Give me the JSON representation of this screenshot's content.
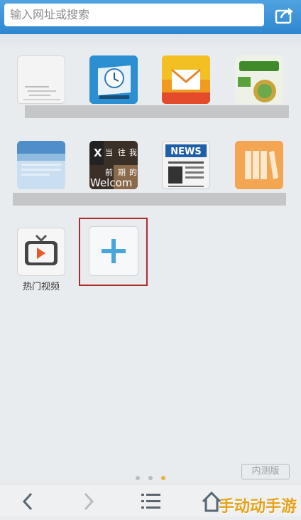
{
  "search": {
    "placeholder": "输入网址或搜索"
  },
  "tiles_row1": [
    {
      "id": "webpage-thumbnail",
      "label": ""
    },
    {
      "id": "clock-app",
      "label": ""
    },
    {
      "id": "mail-app",
      "label": ""
    },
    {
      "id": "android-site",
      "label": ""
    }
  ],
  "tiles_row2": [
    {
      "id": "blue-webpage",
      "label": ""
    },
    {
      "id": "welcome-page",
      "label": ""
    },
    {
      "id": "news-app",
      "label": ""
    },
    {
      "id": "books-app",
      "label": ""
    }
  ],
  "tiles_row3": [
    {
      "id": "hot-video",
      "label": "热门视频"
    }
  ],
  "welcome_tile": {
    "line1": [
      "当",
      "往",
      "我"
    ],
    "line2": [
      "前",
      "期",
      "的"
    ],
    "big": "Welcom"
  },
  "news_tile": {
    "text": "NEWS"
  },
  "pager": {
    "pages": 3,
    "active": 2,
    "active_color": "#e8b23a",
    "inactive_color": "#b8bcc0"
  },
  "beta_badge": {
    "text": "内测版"
  },
  "bottom_nav": [
    "back-arrow-icon",
    "forward-arrow-icon",
    "menu-icon",
    "home-icon"
  ],
  "watermark": {
    "text": "手动动手游"
  },
  "colors": {
    "accent": "#2d86cf",
    "highlight_outline": "#b02a2a"
  }
}
